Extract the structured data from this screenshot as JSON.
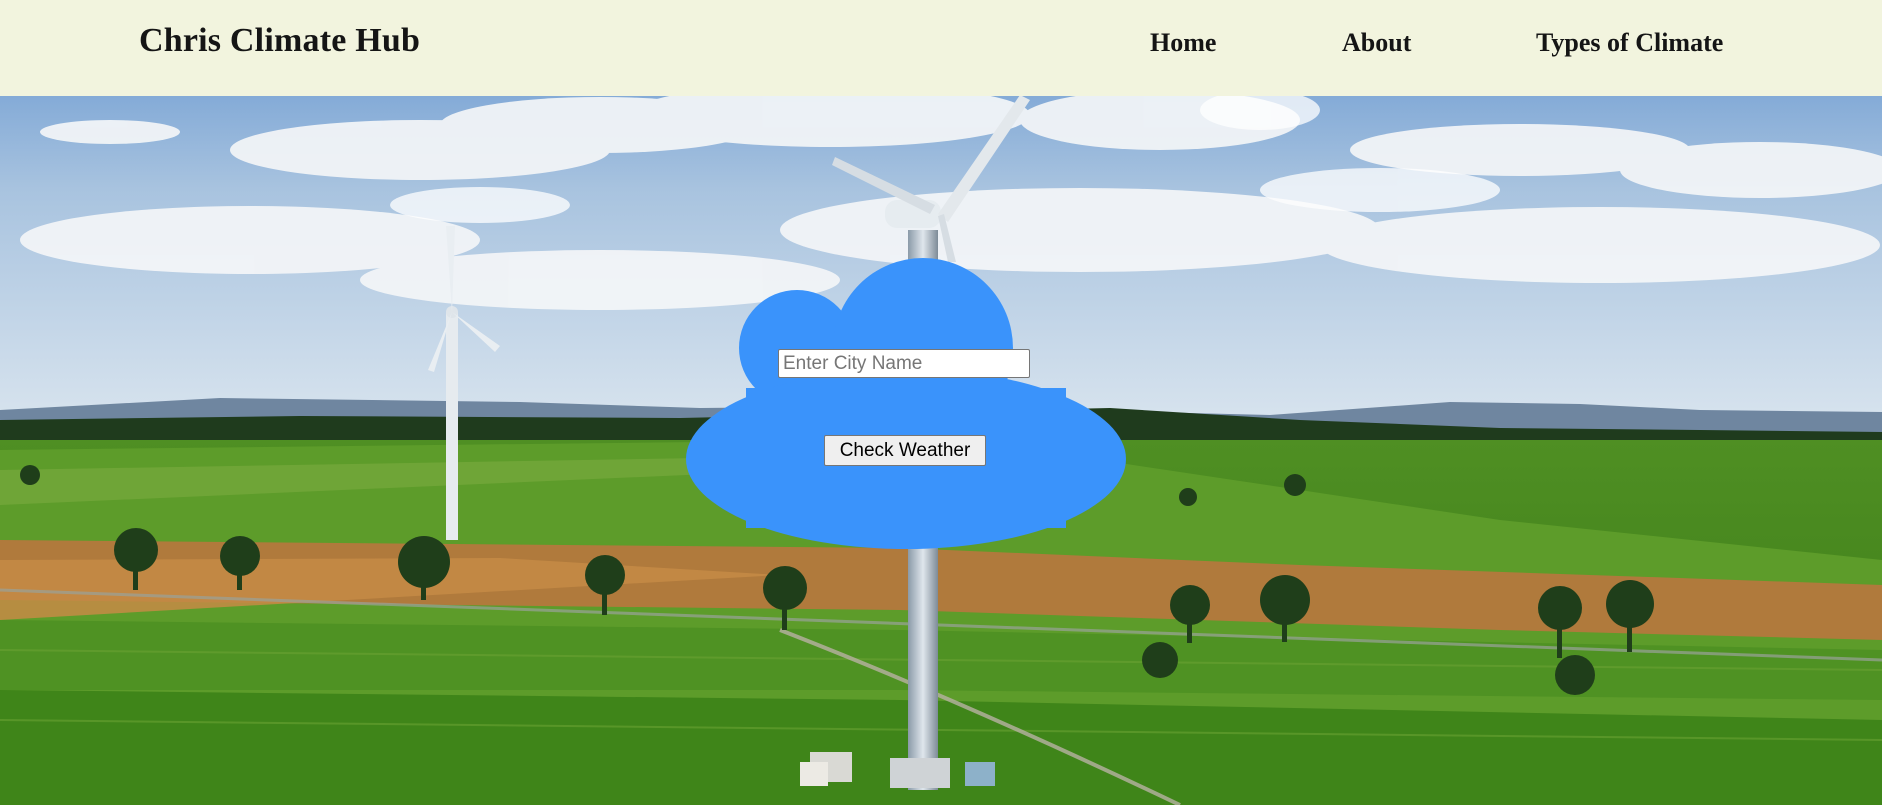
{
  "header": {
    "brand": "Chris Climate Hub",
    "nav": {
      "home": "Home",
      "about": "About",
      "types": "Types of Climate"
    }
  },
  "weather_form": {
    "city_placeholder": "Enter City Name",
    "city_value": "",
    "submit_label": "Check Weather"
  },
  "colors": {
    "navbar_bg": "#f2f4de",
    "cloud_fill": "#3a93fb",
    "text_dark": "#151515"
  },
  "icons": [
    "cloud-shape",
    "wind-turbine-image"
  ]
}
